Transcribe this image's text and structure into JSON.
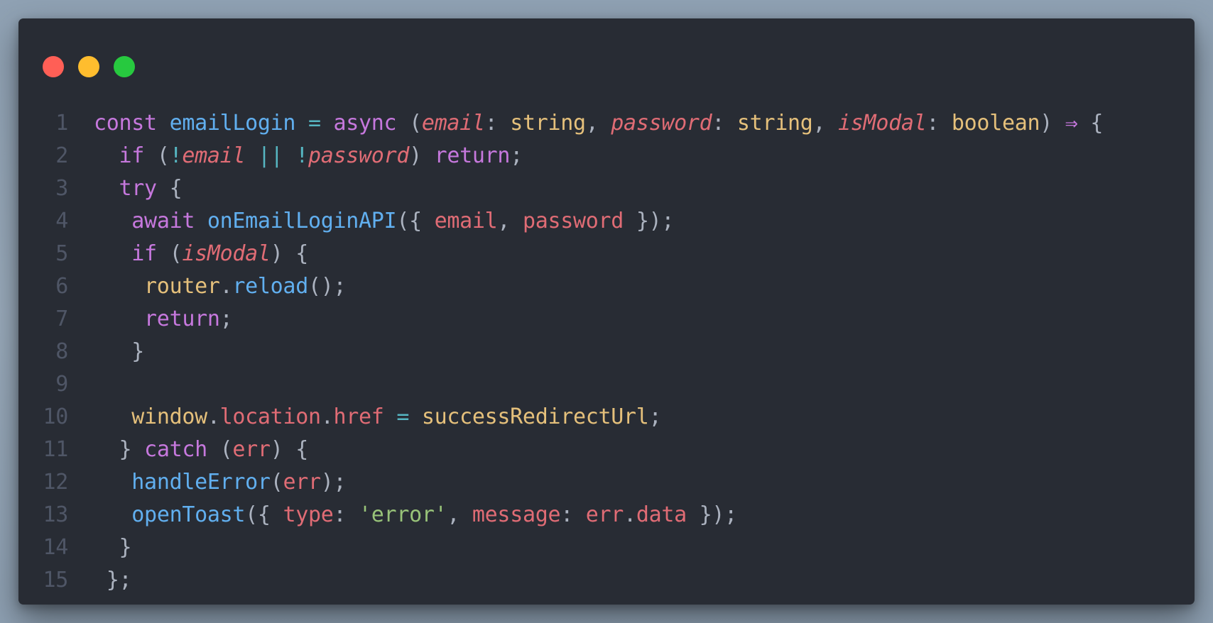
{
  "window": {
    "controls": [
      {
        "name": "close",
        "color": "#ff5f56"
      },
      {
        "name": "minimize",
        "color": "#ffbd2e"
      },
      {
        "name": "maximize",
        "color": "#27c93f"
      }
    ]
  },
  "colors": {
    "background": "#282c34",
    "keyword": "#c678dd",
    "function": "#61afef",
    "variable": "#e06c75",
    "type": "#e5c07b",
    "string": "#98c379",
    "operator": "#56b6c2",
    "plain": "#abb2bf",
    "line_number": "#4f5666"
  },
  "code": {
    "lines": [
      {
        "num": "1",
        "tokens": [
          {
            "t": "const ",
            "c": "kw"
          },
          {
            "t": "emailLogin ",
            "c": "fn"
          },
          {
            "t": "= ",
            "c": "op"
          },
          {
            "t": "async ",
            "c": "kw"
          },
          {
            "t": "(",
            "c": "pl"
          },
          {
            "t": "email",
            "c": "vr it"
          },
          {
            "t": ": ",
            "c": "pl"
          },
          {
            "t": "string",
            "c": "ty"
          },
          {
            "t": ", ",
            "c": "pl"
          },
          {
            "t": "password",
            "c": "vr it"
          },
          {
            "t": ": ",
            "c": "pl"
          },
          {
            "t": "string",
            "c": "ty"
          },
          {
            "t": ", ",
            "c": "pl"
          },
          {
            "t": "isModal",
            "c": "vr it"
          },
          {
            "t": ": ",
            "c": "pl"
          },
          {
            "t": "boolean",
            "c": "ty"
          },
          {
            "t": ") ",
            "c": "pl"
          },
          {
            "t": "⇒ ",
            "c": "kw"
          },
          {
            "t": "{",
            "c": "pl"
          }
        ]
      },
      {
        "num": "2",
        "tokens": [
          {
            "t": "  ",
            "c": "pl"
          },
          {
            "t": "if ",
            "c": "kw"
          },
          {
            "t": "(",
            "c": "pl"
          },
          {
            "t": "!",
            "c": "op"
          },
          {
            "t": "email ",
            "c": "vr it"
          },
          {
            "t": "|| ",
            "c": "op"
          },
          {
            "t": "!",
            "c": "op"
          },
          {
            "t": "password",
            "c": "vr it"
          },
          {
            "t": ") ",
            "c": "pl"
          },
          {
            "t": "return",
            "c": "kw"
          },
          {
            "t": ";",
            "c": "pl"
          }
        ]
      },
      {
        "num": "3",
        "tokens": [
          {
            "t": "  ",
            "c": "pl"
          },
          {
            "t": "try ",
            "c": "kw"
          },
          {
            "t": "{",
            "c": "pl"
          }
        ]
      },
      {
        "num": "4",
        "tokens": [
          {
            "t": "   ",
            "c": "pl"
          },
          {
            "t": "await ",
            "c": "kw"
          },
          {
            "t": "onEmailLoginAPI",
            "c": "fn"
          },
          {
            "t": "({ ",
            "c": "pl"
          },
          {
            "t": "email",
            "c": "vr"
          },
          {
            "t": ", ",
            "c": "pl"
          },
          {
            "t": "password ",
            "c": "vr"
          },
          {
            "t": "});",
            "c": "pl"
          }
        ]
      },
      {
        "num": "5",
        "tokens": [
          {
            "t": "   ",
            "c": "pl"
          },
          {
            "t": "if ",
            "c": "kw"
          },
          {
            "t": "(",
            "c": "pl"
          },
          {
            "t": "isModal",
            "c": "vr it"
          },
          {
            "t": ") {",
            "c": "pl"
          }
        ]
      },
      {
        "num": "6",
        "tokens": [
          {
            "t": "    ",
            "c": "pl"
          },
          {
            "t": "router",
            "c": "ty"
          },
          {
            "t": ".",
            "c": "pl"
          },
          {
            "t": "reload",
            "c": "fn"
          },
          {
            "t": "();",
            "c": "pl"
          }
        ]
      },
      {
        "num": "7",
        "tokens": [
          {
            "t": "    ",
            "c": "pl"
          },
          {
            "t": "return",
            "c": "kw"
          },
          {
            "t": ";",
            "c": "pl"
          }
        ]
      },
      {
        "num": "8",
        "tokens": [
          {
            "t": "   ",
            "c": "pl"
          },
          {
            "t": "}",
            "c": "pl"
          }
        ]
      },
      {
        "num": "9",
        "tokens": []
      },
      {
        "num": "10",
        "tokens": [
          {
            "t": "   ",
            "c": "pl"
          },
          {
            "t": "window",
            "c": "ty"
          },
          {
            "t": ".",
            "c": "pl"
          },
          {
            "t": "location",
            "c": "vr"
          },
          {
            "t": ".",
            "c": "pl"
          },
          {
            "t": "href ",
            "c": "vr"
          },
          {
            "t": "= ",
            "c": "op"
          },
          {
            "t": "successRedirectUrl",
            "c": "ty"
          },
          {
            "t": ";",
            "c": "pl"
          }
        ]
      },
      {
        "num": "11",
        "tokens": [
          {
            "t": "  ",
            "c": "pl"
          },
          {
            "t": "} ",
            "c": "pl"
          },
          {
            "t": "catch ",
            "c": "kw"
          },
          {
            "t": "(",
            "c": "pl"
          },
          {
            "t": "err",
            "c": "vr"
          },
          {
            "t": ") {",
            "c": "pl"
          }
        ]
      },
      {
        "num": "12",
        "tokens": [
          {
            "t": "   ",
            "c": "pl"
          },
          {
            "t": "handleError",
            "c": "fn"
          },
          {
            "t": "(",
            "c": "pl"
          },
          {
            "t": "err",
            "c": "vr"
          },
          {
            "t": ");",
            "c": "pl"
          }
        ]
      },
      {
        "num": "13",
        "tokens": [
          {
            "t": "   ",
            "c": "pl"
          },
          {
            "t": "openToast",
            "c": "fn"
          },
          {
            "t": "({ ",
            "c": "pl"
          },
          {
            "t": "type",
            "c": "vr"
          },
          {
            "t": ": ",
            "c": "pl"
          },
          {
            "t": "'error'",
            "c": "st"
          },
          {
            "t": ", ",
            "c": "pl"
          },
          {
            "t": "message",
            "c": "vr"
          },
          {
            "t": ": ",
            "c": "pl"
          },
          {
            "t": "err",
            "c": "vr"
          },
          {
            "t": ".",
            "c": "pl"
          },
          {
            "t": "data ",
            "c": "vr"
          },
          {
            "t": "});",
            "c": "pl"
          }
        ]
      },
      {
        "num": "14",
        "tokens": [
          {
            "t": "  ",
            "c": "pl"
          },
          {
            "t": "}",
            "c": "pl"
          }
        ]
      },
      {
        "num": "15",
        "tokens": [
          {
            "t": " ",
            "c": "pl"
          },
          {
            "t": "};",
            "c": "pl"
          }
        ]
      }
    ]
  }
}
